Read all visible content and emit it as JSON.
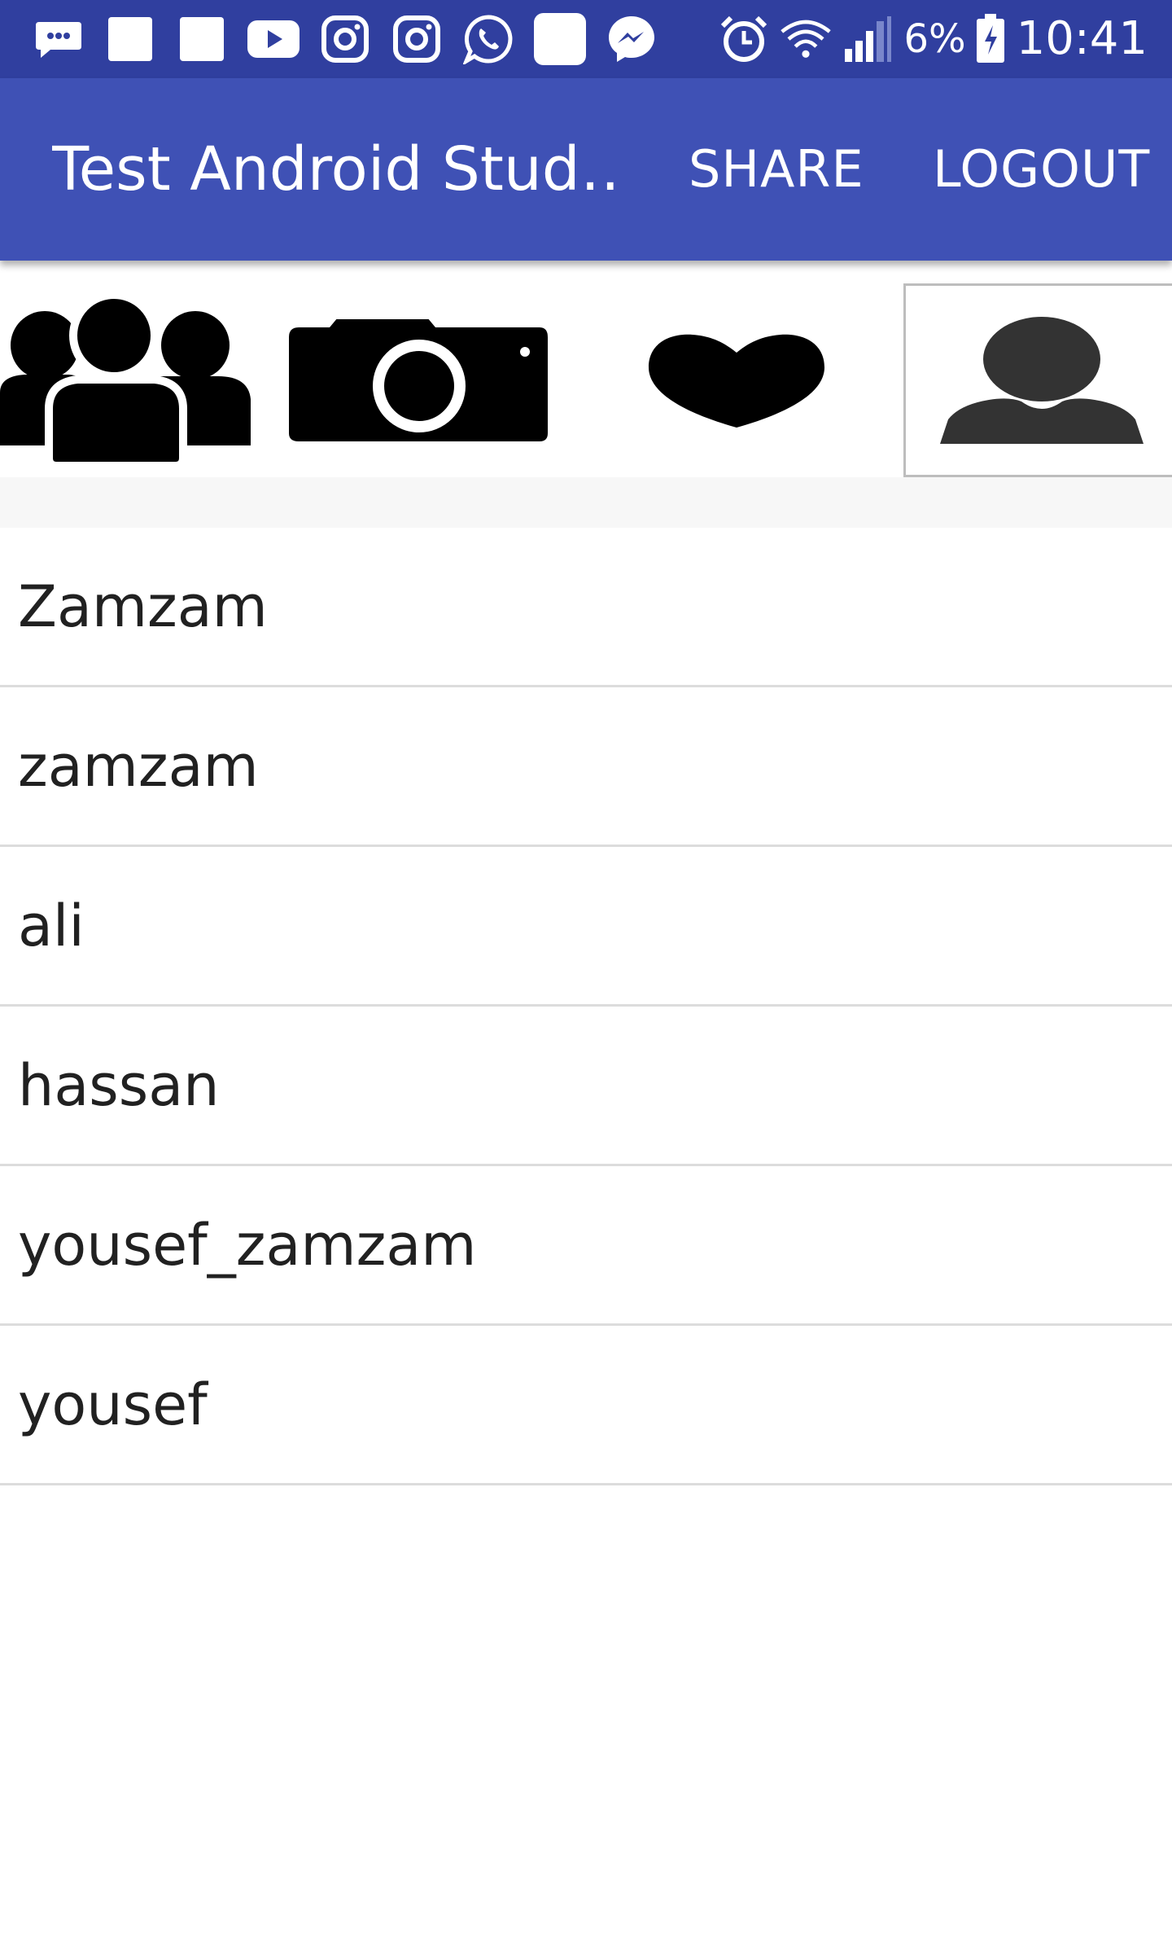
{
  "status_bar": {
    "left_icons": [
      "chat-bubble-icon",
      "white-square-icon",
      "white-square-icon",
      "youtube-icon",
      "instagram-icon",
      "instagram-icon",
      "whatsapp-icon",
      "white-rounded-square-icon",
      "messenger-icon"
    ],
    "right_icons": [
      "alarm-icon",
      "wifi-icon",
      "signal-icon",
      "battery-charging-icon"
    ],
    "battery_percent": "6%",
    "time": "10:41",
    "background_color": "#303f9f"
  },
  "app_bar": {
    "title": "Test Android Stud…",
    "share_label": "SHARE",
    "logout_label": "LOGOUT",
    "background_color": "#3f51b5"
  },
  "tabs": [
    {
      "icon": "friends-icon"
    },
    {
      "icon": "camera-icon"
    },
    {
      "icon": "heart-icon"
    },
    {
      "icon": "profile-icon",
      "selected": true
    }
  ],
  "users": [
    "Zamzam",
    "zamzam",
    "ali",
    "hassan",
    "yousef_zamzam",
    "yousef"
  ]
}
